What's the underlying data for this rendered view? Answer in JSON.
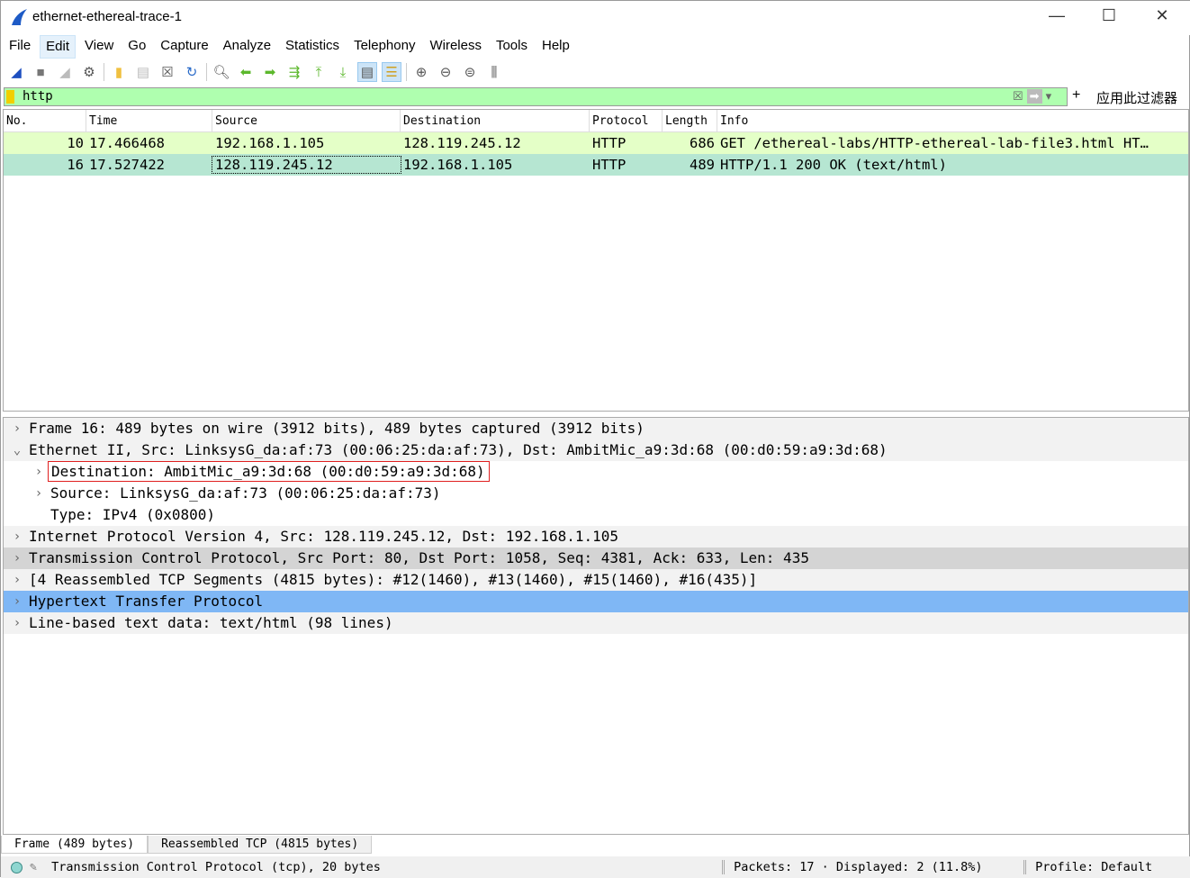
{
  "window": {
    "title": "ethernet-ethereal-trace-1",
    "minimize": "—",
    "maximize": "☐",
    "close": "✕"
  },
  "menu": [
    "File",
    "Edit",
    "View",
    "Go",
    "Capture",
    "Analyze",
    "Statistics",
    "Telephony",
    "Wireless",
    "Tools",
    "Help"
  ],
  "toolbar": [
    "shark-fin-icon",
    "stop-icon",
    "restart-icon",
    "options-gear-icon",
    "open-folder-icon",
    "file-icon",
    "close-file-icon",
    "reload-icon",
    "find-icon",
    "back-arrow-icon",
    "forward-arrow-icon",
    "go-to-packet-icon",
    "first-packet-icon",
    "last-packet-icon",
    "autoscroll-icon",
    "colorize-icon",
    "zoom-in-icon",
    "zoom-out-icon",
    "zoom-normal-icon",
    "resize-columns-icon"
  ],
  "filter": {
    "value": "http",
    "apply_label": "应用此过滤器",
    "plus": "+"
  },
  "packet_list": {
    "columns": [
      "No.",
      "Time",
      "Source",
      "Destination",
      "Protocol",
      "Length",
      "Info"
    ],
    "rows": [
      {
        "no": "10",
        "time": "17.466468",
        "source": "192.168.1.105",
        "destination": "128.119.245.12",
        "protocol": "HTTP",
        "length": "686",
        "info": "GET /ethereal-labs/HTTP-ethereal-lab-file3.html HT…",
        "color": "#e4ffc7"
      },
      {
        "no": "16",
        "time": "17.527422",
        "source": "128.119.245.12",
        "destination": "192.168.1.105",
        "protocol": "HTTP",
        "length": "489",
        "info": "HTTP/1.1 200 OK  (text/html)",
        "color": "#b6e6d2"
      }
    ]
  },
  "details": [
    {
      "text": "Frame 16: 489 bytes on wire (3912 bits), 489 bytes captured (3912 bits)",
      "arrow": "›",
      "indent": 0,
      "bg": "#f2f2f2"
    },
    {
      "text": "Ethernet II, Src: LinksysG_da:af:73 (00:06:25:da:af:73), Dst: AmbitMic_a9:3d:68 (00:d0:59:a9:3d:68)",
      "arrow": "⌄",
      "indent": 0,
      "bg": "#f2f2f2"
    },
    {
      "text": "Destination: AmbitMic_a9:3d:68 (00:d0:59:a9:3d:68)",
      "arrow": "›",
      "indent": 1,
      "bg": "#fff",
      "boxed": true
    },
    {
      "text": "Source: LinksysG_da:af:73 (00:06:25:da:af:73)",
      "arrow": "›",
      "indent": 1,
      "bg": "#fff"
    },
    {
      "text": "Type: IPv4 (0x0800)",
      "arrow": "",
      "indent": 1,
      "bg": "#fff"
    },
    {
      "text": "Internet Protocol Version 4, Src: 128.119.245.12, Dst: 192.168.1.105",
      "arrow": "›",
      "indent": 0,
      "bg": "#f2f2f2"
    },
    {
      "text": "Transmission Control Protocol, Src Port: 80, Dst Port: 1058, Seq: 4381, Ack: 633, Len: 435",
      "arrow": "›",
      "indent": 0,
      "bg": "#d4d4d4"
    },
    {
      "text": "[4 Reassembled TCP Segments (4815 bytes): #12(1460), #13(1460), #15(1460), #16(435)]",
      "arrow": "›",
      "indent": 0,
      "bg": "#f2f2f2"
    },
    {
      "text": "Hypertext Transfer Protocol",
      "arrow": "›",
      "indent": 0,
      "bg": "#7fb7f5"
    },
    {
      "text": "Line-based text data: text/html (98 lines)",
      "arrow": "›",
      "indent": 0,
      "bg": "#f2f2f2"
    }
  ],
  "byte_tabs": [
    "Frame (489 bytes)",
    "Reassembled TCP (4815 bytes)"
  ],
  "status": {
    "field": "Transmission Control Protocol (tcp), 20 bytes",
    "packets": "Packets: 17 · Displayed: 2 (11.8%)",
    "profile": "Profile: Default"
  }
}
